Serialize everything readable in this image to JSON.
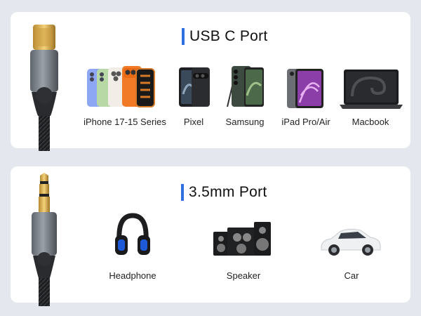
{
  "usb_section": {
    "title": "USB C Port",
    "devices": [
      {
        "label": "iPhone 17-15 Series",
        "icon": "iphone-icon"
      },
      {
        "label": "Pixel",
        "icon": "pixel-phone-icon"
      },
      {
        "label": "Samsung",
        "icon": "samsung-phone-icon"
      },
      {
        "label": "iPad Pro/Air",
        "icon": "ipad-icon"
      },
      {
        "label": "Macbook",
        "icon": "macbook-icon"
      }
    ]
  },
  "aux_section": {
    "title": "3.5mm Port",
    "devices": [
      {
        "label": "Headphone",
        "icon": "headphone-icon"
      },
      {
        "label": "Speaker",
        "icon": "speaker-icon"
      },
      {
        "label": "Car",
        "icon": "car-icon"
      }
    ]
  },
  "colors": {
    "accent": "#2f6fe0",
    "background": "#e4e8ee",
    "card": "#ffffff"
  }
}
